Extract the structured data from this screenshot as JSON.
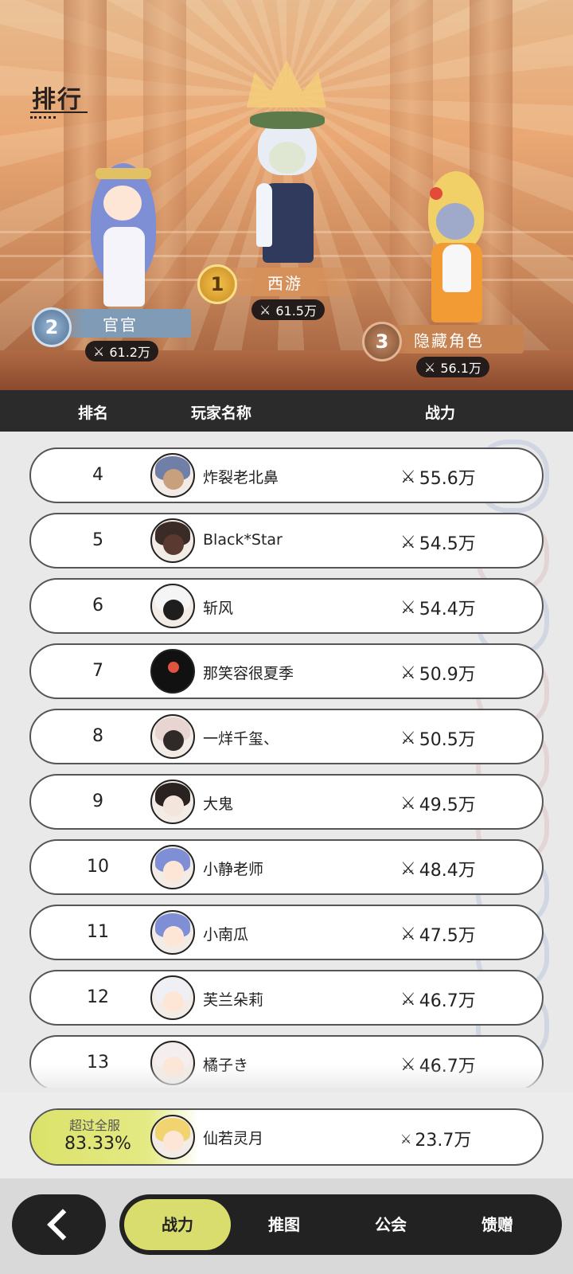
{
  "page": {
    "title": "排行"
  },
  "podium": [
    {
      "rank": "1",
      "name": "西游",
      "power": "61.5万"
    },
    {
      "rank": "2",
      "name": "官官",
      "power": "61.2万"
    },
    {
      "rank": "3",
      "name": "隐藏角色",
      "power": "56.1万"
    }
  ],
  "header": {
    "rank": "排名",
    "player": "玩家名称",
    "power": "战力"
  },
  "rows": [
    {
      "rank": "4",
      "name": "炸裂老北鼻",
      "power": "55.6万"
    },
    {
      "rank": "5",
      "name": "Black*Star",
      "power": "54.5万"
    },
    {
      "rank": "6",
      "name": "斩风",
      "power": "54.4万"
    },
    {
      "rank": "7",
      "name": "那笑容很夏季",
      "power": "50.9万"
    },
    {
      "rank": "8",
      "name": "一烊千玺、",
      "power": "50.5万"
    },
    {
      "rank": "9",
      "name": "大鬼",
      "power": "49.5万"
    },
    {
      "rank": "10",
      "name": "小静老师",
      "power": "48.4万"
    },
    {
      "rank": "11",
      "name": "小南瓜",
      "power": "47.5万"
    },
    {
      "rank": "12",
      "name": "芙兰朵莉",
      "power": "46.7万"
    },
    {
      "rank": "13",
      "name": "橘子き",
      "power": "46.7万"
    }
  ],
  "my_rank": {
    "label": "超过全服",
    "percent": "83.33%",
    "name": "仙若灵月",
    "power": "23.7万"
  },
  "tabs": [
    {
      "label": "战力",
      "active": true
    },
    {
      "label": "推图",
      "active": false
    },
    {
      "label": "公会",
      "active": false
    },
    {
      "label": "馈赠",
      "active": false
    }
  ],
  "icons": {
    "power": "crossed-swords-icon",
    "back": "chevron-left-icon"
  },
  "colors": {
    "active_tab": "#d9dd6e",
    "dark": "#222222",
    "banner": "#e9a874"
  }
}
